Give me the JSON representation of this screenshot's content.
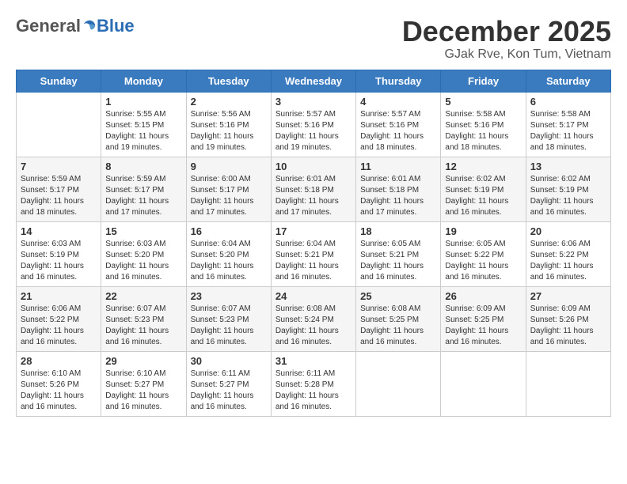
{
  "logo": {
    "general": "General",
    "blue": "Blue"
  },
  "title": "December 2025",
  "subtitle": "GJak Rve, Kon Tum, Vietnam",
  "weekdays": [
    "Sunday",
    "Monday",
    "Tuesday",
    "Wednesday",
    "Thursday",
    "Friday",
    "Saturday"
  ],
  "weeks": [
    [
      {
        "day": "",
        "info": ""
      },
      {
        "day": "1",
        "info": "Sunrise: 5:55 AM\nSunset: 5:15 PM\nDaylight: 11 hours\nand 19 minutes."
      },
      {
        "day": "2",
        "info": "Sunrise: 5:56 AM\nSunset: 5:16 PM\nDaylight: 11 hours\nand 19 minutes."
      },
      {
        "day": "3",
        "info": "Sunrise: 5:57 AM\nSunset: 5:16 PM\nDaylight: 11 hours\nand 19 minutes."
      },
      {
        "day": "4",
        "info": "Sunrise: 5:57 AM\nSunset: 5:16 PM\nDaylight: 11 hours\nand 18 minutes."
      },
      {
        "day": "5",
        "info": "Sunrise: 5:58 AM\nSunset: 5:16 PM\nDaylight: 11 hours\nand 18 minutes."
      },
      {
        "day": "6",
        "info": "Sunrise: 5:58 AM\nSunset: 5:17 PM\nDaylight: 11 hours\nand 18 minutes."
      }
    ],
    [
      {
        "day": "7",
        "info": "Sunrise: 5:59 AM\nSunset: 5:17 PM\nDaylight: 11 hours\nand 18 minutes."
      },
      {
        "day": "8",
        "info": "Sunrise: 5:59 AM\nSunset: 5:17 PM\nDaylight: 11 hours\nand 17 minutes."
      },
      {
        "day": "9",
        "info": "Sunrise: 6:00 AM\nSunset: 5:17 PM\nDaylight: 11 hours\nand 17 minutes."
      },
      {
        "day": "10",
        "info": "Sunrise: 6:01 AM\nSunset: 5:18 PM\nDaylight: 11 hours\nand 17 minutes."
      },
      {
        "day": "11",
        "info": "Sunrise: 6:01 AM\nSunset: 5:18 PM\nDaylight: 11 hours\nand 17 minutes."
      },
      {
        "day": "12",
        "info": "Sunrise: 6:02 AM\nSunset: 5:19 PM\nDaylight: 11 hours\nand 16 minutes."
      },
      {
        "day": "13",
        "info": "Sunrise: 6:02 AM\nSunset: 5:19 PM\nDaylight: 11 hours\nand 16 minutes."
      }
    ],
    [
      {
        "day": "14",
        "info": "Sunrise: 6:03 AM\nSunset: 5:19 PM\nDaylight: 11 hours\nand 16 minutes."
      },
      {
        "day": "15",
        "info": "Sunrise: 6:03 AM\nSunset: 5:20 PM\nDaylight: 11 hours\nand 16 minutes."
      },
      {
        "day": "16",
        "info": "Sunrise: 6:04 AM\nSunset: 5:20 PM\nDaylight: 11 hours\nand 16 minutes."
      },
      {
        "day": "17",
        "info": "Sunrise: 6:04 AM\nSunset: 5:21 PM\nDaylight: 11 hours\nand 16 minutes."
      },
      {
        "day": "18",
        "info": "Sunrise: 6:05 AM\nSunset: 5:21 PM\nDaylight: 11 hours\nand 16 minutes."
      },
      {
        "day": "19",
        "info": "Sunrise: 6:05 AM\nSunset: 5:22 PM\nDaylight: 11 hours\nand 16 minutes."
      },
      {
        "day": "20",
        "info": "Sunrise: 6:06 AM\nSunset: 5:22 PM\nDaylight: 11 hours\nand 16 minutes."
      }
    ],
    [
      {
        "day": "21",
        "info": "Sunrise: 6:06 AM\nSunset: 5:22 PM\nDaylight: 11 hours\nand 16 minutes."
      },
      {
        "day": "22",
        "info": "Sunrise: 6:07 AM\nSunset: 5:23 PM\nDaylight: 11 hours\nand 16 minutes."
      },
      {
        "day": "23",
        "info": "Sunrise: 6:07 AM\nSunset: 5:23 PM\nDaylight: 11 hours\nand 16 minutes."
      },
      {
        "day": "24",
        "info": "Sunrise: 6:08 AM\nSunset: 5:24 PM\nDaylight: 11 hours\nand 16 minutes."
      },
      {
        "day": "25",
        "info": "Sunrise: 6:08 AM\nSunset: 5:25 PM\nDaylight: 11 hours\nand 16 minutes."
      },
      {
        "day": "26",
        "info": "Sunrise: 6:09 AM\nSunset: 5:25 PM\nDaylight: 11 hours\nand 16 minutes."
      },
      {
        "day": "27",
        "info": "Sunrise: 6:09 AM\nSunset: 5:26 PM\nDaylight: 11 hours\nand 16 minutes."
      }
    ],
    [
      {
        "day": "28",
        "info": "Sunrise: 6:10 AM\nSunset: 5:26 PM\nDaylight: 11 hours\nand 16 minutes."
      },
      {
        "day": "29",
        "info": "Sunrise: 6:10 AM\nSunset: 5:27 PM\nDaylight: 11 hours\nand 16 minutes."
      },
      {
        "day": "30",
        "info": "Sunrise: 6:11 AM\nSunset: 5:27 PM\nDaylight: 11 hours\nand 16 minutes."
      },
      {
        "day": "31",
        "info": "Sunrise: 6:11 AM\nSunset: 5:28 PM\nDaylight: 11 hours\nand 16 minutes."
      },
      {
        "day": "",
        "info": ""
      },
      {
        "day": "",
        "info": ""
      },
      {
        "day": "",
        "info": ""
      }
    ]
  ]
}
